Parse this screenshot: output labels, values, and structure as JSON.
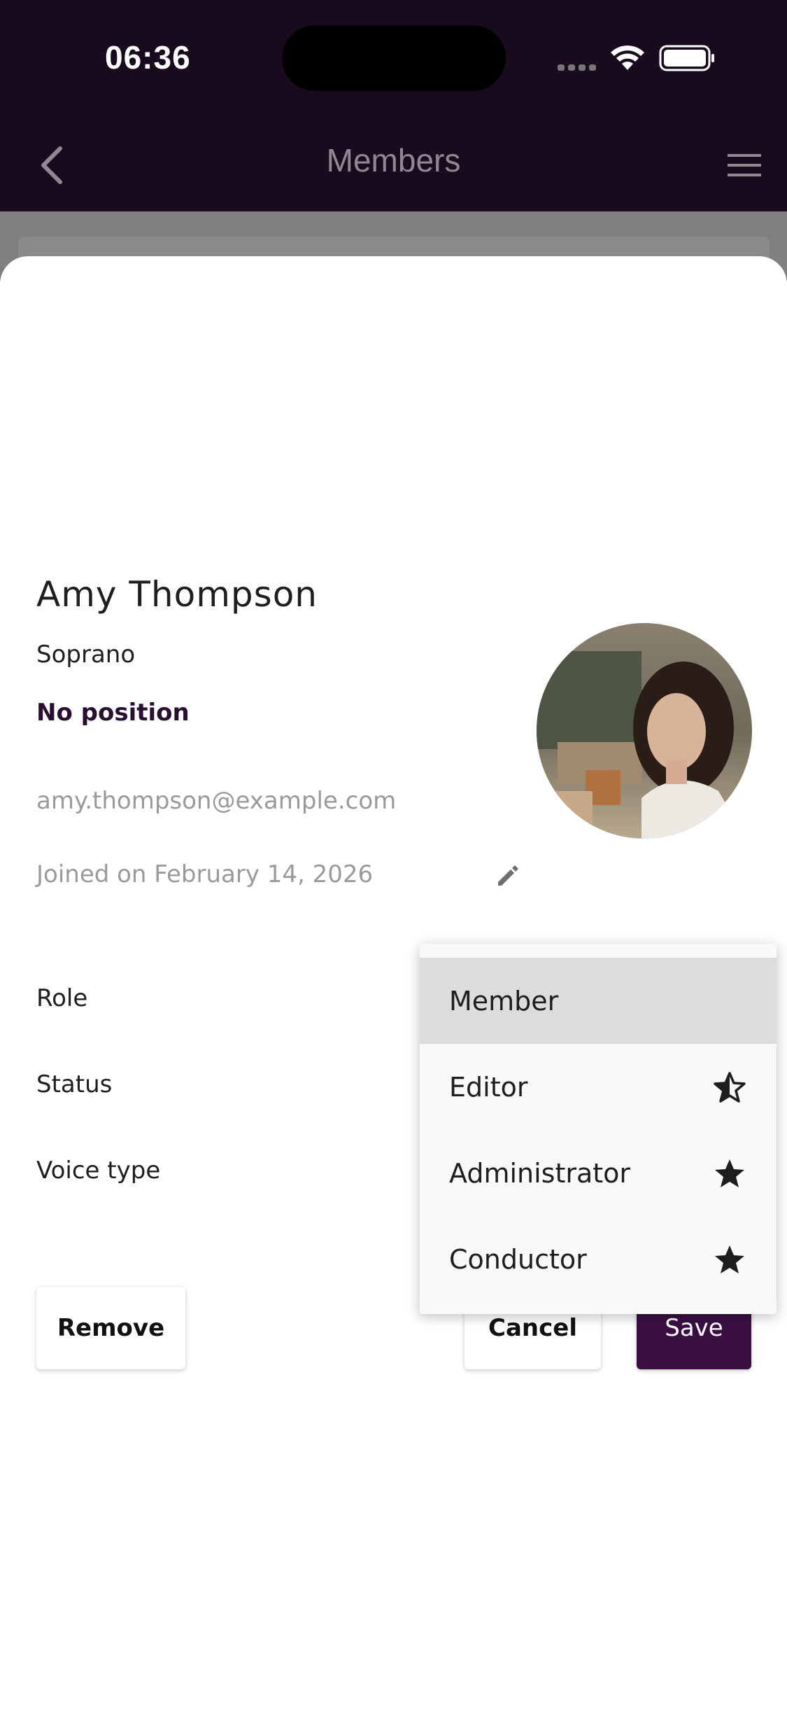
{
  "status_bar": {
    "time": "06:36"
  },
  "app_bar": {
    "title": "Members"
  },
  "member": {
    "name": "Amy Thompson",
    "voice_type": "Soprano",
    "position": "No position",
    "email": "amy.thompson@example.com",
    "joined": "Joined on February 14, 2026"
  },
  "fields": {
    "role": "Role",
    "status": "Status",
    "voice_type": "Voice type"
  },
  "buttons": {
    "remove": "Remove",
    "cancel": "Cancel",
    "save": "Save"
  },
  "role_menu": {
    "selected": "Member",
    "items": [
      {
        "label": "Member",
        "icon": ""
      },
      {
        "label": "Editor",
        "icon": "star-half-icon"
      },
      {
        "label": "Administrator",
        "icon": "star-icon"
      },
      {
        "label": "Conductor",
        "icon": "star-icon"
      }
    ]
  },
  "colors": {
    "app_bar": "#1a0a1e",
    "accent": "#3a0f42"
  }
}
